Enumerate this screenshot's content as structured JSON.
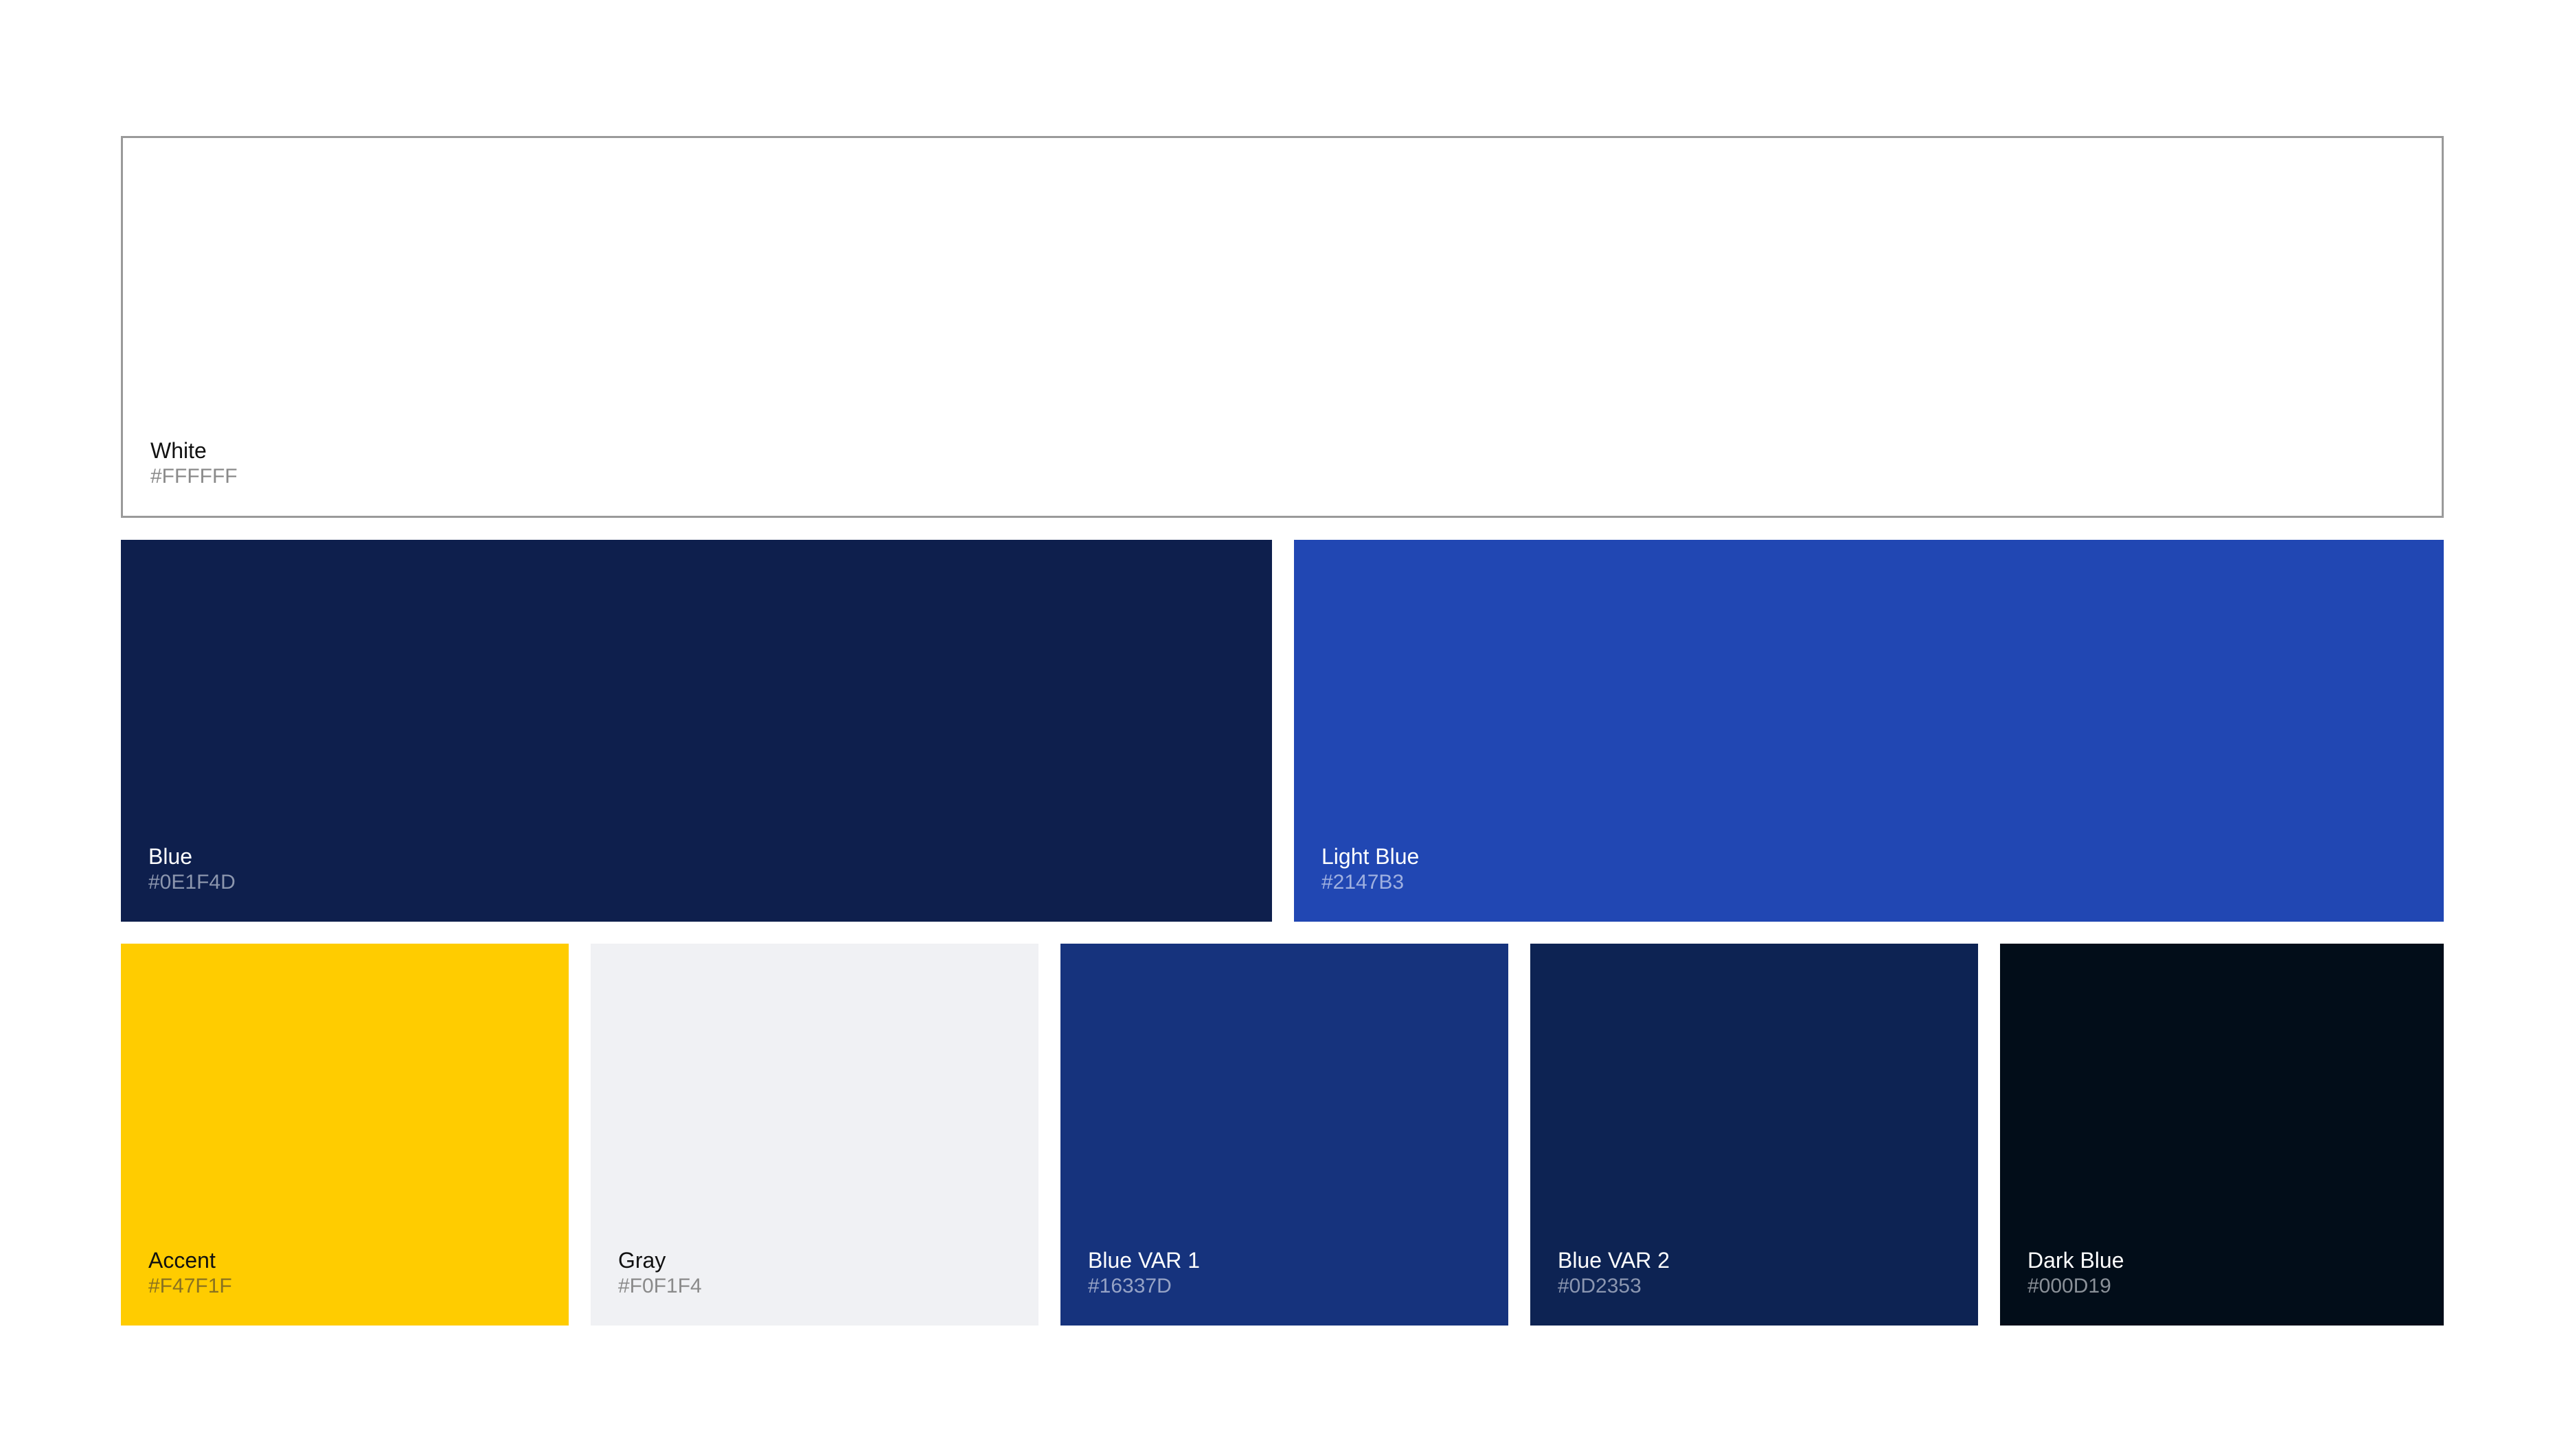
{
  "swatches": {
    "white": {
      "name": "White",
      "hex": "#FFFFFF",
      "color": "#FFFFFF",
      "text_color": "#111111",
      "hex_text_color": "#8A8A8A"
    },
    "blue": {
      "name": "Blue",
      "hex": "#0E1F4D",
      "color": "#0E1F4D",
      "text_color": "#FFFFFF",
      "hex_text_color": "#8C96AE"
    },
    "light_blue": {
      "name": "Light Blue",
      "hex": "#2147B3",
      "color": "#2147B3",
      "text_color": "#FFFFFF",
      "hex_text_color": "#9FB0E0"
    },
    "accent": {
      "name": "Accent",
      "hex": "#F47F1F",
      "color": "#FFCC00",
      "text_color": "#111111",
      "hex_text_color": "#8A7220"
    },
    "gray": {
      "name": "Gray",
      "hex": "#F0F1F4",
      "color": "#F0F1F4",
      "text_color": "#111111",
      "hex_text_color": "#8A8A8A"
    },
    "blue_var_1": {
      "name": "Blue VAR 1",
      "hex": "#16337D",
      "color": "#16337D",
      "text_color": "#FFFFFF",
      "hex_text_color": "#96A3C6"
    },
    "blue_var_2": {
      "name": "Blue VAR 2",
      "hex": "#0D2353",
      "color": "#0D2353",
      "text_color": "#FFFFFF",
      "hex_text_color": "#8B96B0"
    },
    "dark_blue": {
      "name": "Dark Blue",
      "hex": "#000D19",
      "color": "#020D19",
      "text_color": "#FFFFFF",
      "hex_text_color": "#8A9098"
    }
  }
}
